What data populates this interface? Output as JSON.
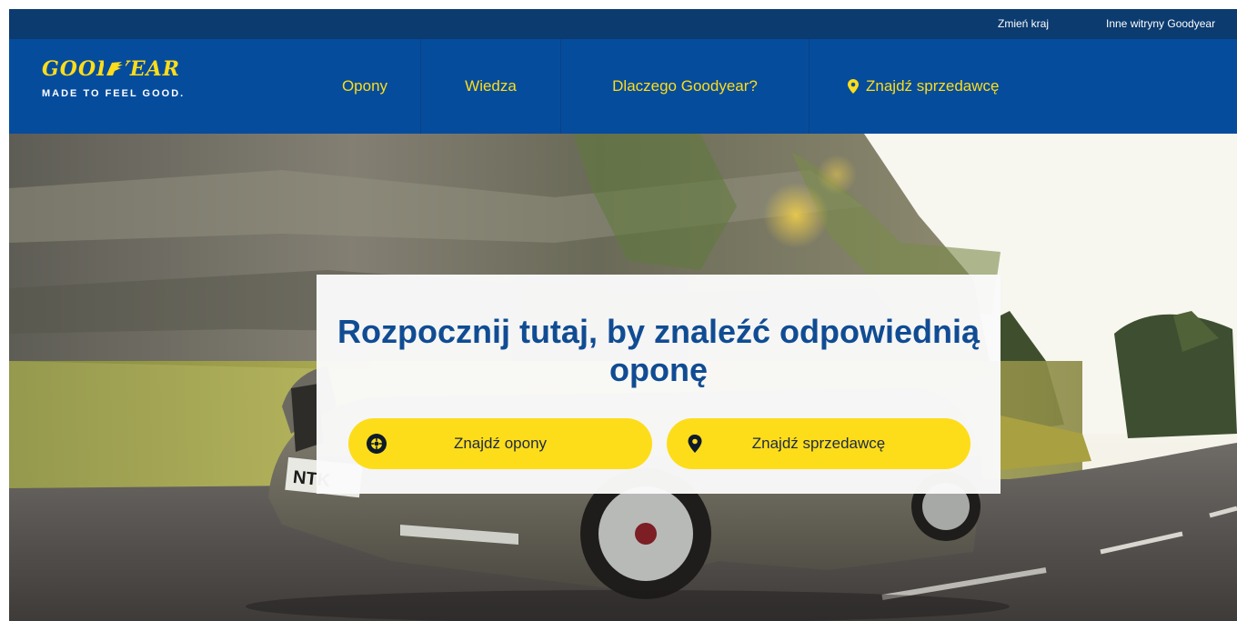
{
  "utility_bar": {
    "change_country": "Zmień kraj",
    "other_sites": "Inne witryny Goodyear"
  },
  "logo": {
    "wordmark": "GOODYEAR",
    "tagline": "MADE TO FEEL GOOD."
  },
  "nav": {
    "items": [
      {
        "label": "Opony"
      },
      {
        "label": "Wiedza"
      },
      {
        "label": "Dlaczego Goodyear?"
      },
      {
        "label": "Znajdź sprzedawcę",
        "icon": "location-pin-icon"
      }
    ]
  },
  "hero": {
    "title": "Rozpocznij tutaj, by znaleźć odpowiednią oponę",
    "buttons": {
      "find_tires": {
        "label": "Znajdź opony",
        "icon": "tire-icon"
      },
      "find_dealer": {
        "label": "Znajdź sprzedawcę",
        "icon": "location-pin-icon"
      }
    },
    "plate_text": "NTK"
  },
  "colors": {
    "brand_blue": "#064c9d",
    "utility_blue": "#0b3b6f",
    "brand_yellow": "#fddd1a",
    "title_blue": "#104c93"
  }
}
